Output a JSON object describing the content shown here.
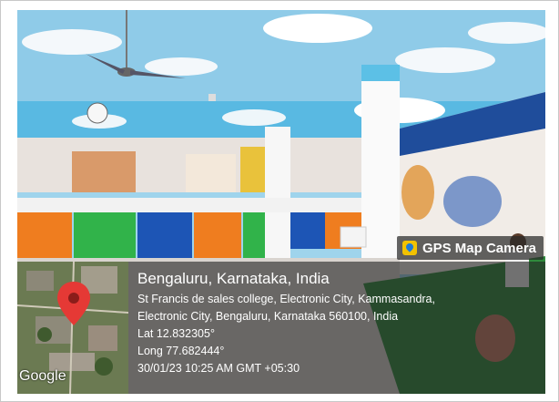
{
  "overlay": {
    "badge_label": "GPS Map Camera",
    "badge_icon": "map-pin-icon",
    "map_brand": "Google",
    "city": "Bengaluru, Karnataka, India",
    "address_line1": "St Francis de sales college, Electronic City, Kammasandra,",
    "address_line2": "Electronic City, Bengaluru, Karnataka 560100, India",
    "latitude": "Lat 12.832305°",
    "longitude": "Long 77.682444°",
    "timestamp": "30/01/23 10:25 AM GMT +05:30"
  },
  "colors": {
    "pin": "#e53935",
    "panel": "#232323",
    "badge": "#282828"
  }
}
